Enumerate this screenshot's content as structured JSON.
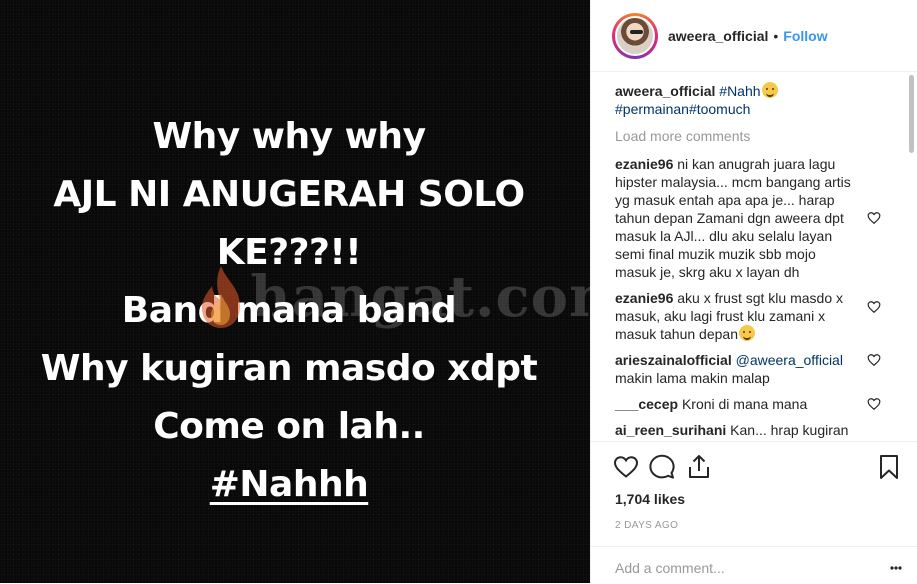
{
  "image": {
    "lines": [
      "Why why why",
      "AJL NI ANUGERAH SOLO",
      "KE???!!",
      "Band mana band",
      "Why kugiran masdo xdpt",
      "Come on lah..",
      "#Nahhh"
    ],
    "watermark": "hangat.com"
  },
  "header": {
    "username": "aweera_official",
    "separator": "•",
    "follow_label": "Follow"
  },
  "caption": {
    "username": "aweera_official",
    "tag1": "#Nahh",
    "tag2": "#permainan",
    "tag3": "#toomuch"
  },
  "load_more": "Load more comments",
  "comments": [
    {
      "username": "ezanie96",
      "text": "ni kan anugrah juara lagu hipster malaysia... mcm bangang artis yg masuk entah apa apa je... harap tahun depan Zamani dgn aweera dpt masuk la AJl... dlu aku selalu layan semi final muzik muzik sbb mojo masuk je, skrg aku x layan dh"
    },
    {
      "username": "ezanie96",
      "text": "aku x frust sgt klu masdo x masuk, aku lagi frust klu zamani x masuk tahun depan"
    },
    {
      "username": "arieszainalofficial",
      "mention": "@aweera_official",
      "text": "makin lama makin malap"
    },
    {
      "username": "___cecep",
      "text": "Kroni di mana mana"
    },
    {
      "username": "ai_reen_surihani",
      "text": "Kan... hrap kugiran"
    }
  ],
  "likes": "1,704 likes",
  "timestamp": "2 DAYS AGO",
  "add_comment_placeholder": "Add a comment...",
  "colors": {
    "link": "#3897f0",
    "hashtag": "#003569",
    "muted": "#999999",
    "text": "#262626",
    "border": "#efefef",
    "image_bg": "#080808"
  },
  "icons": [
    "heart-icon",
    "comment-icon",
    "share-icon",
    "bookmark-icon",
    "post-icon"
  ]
}
